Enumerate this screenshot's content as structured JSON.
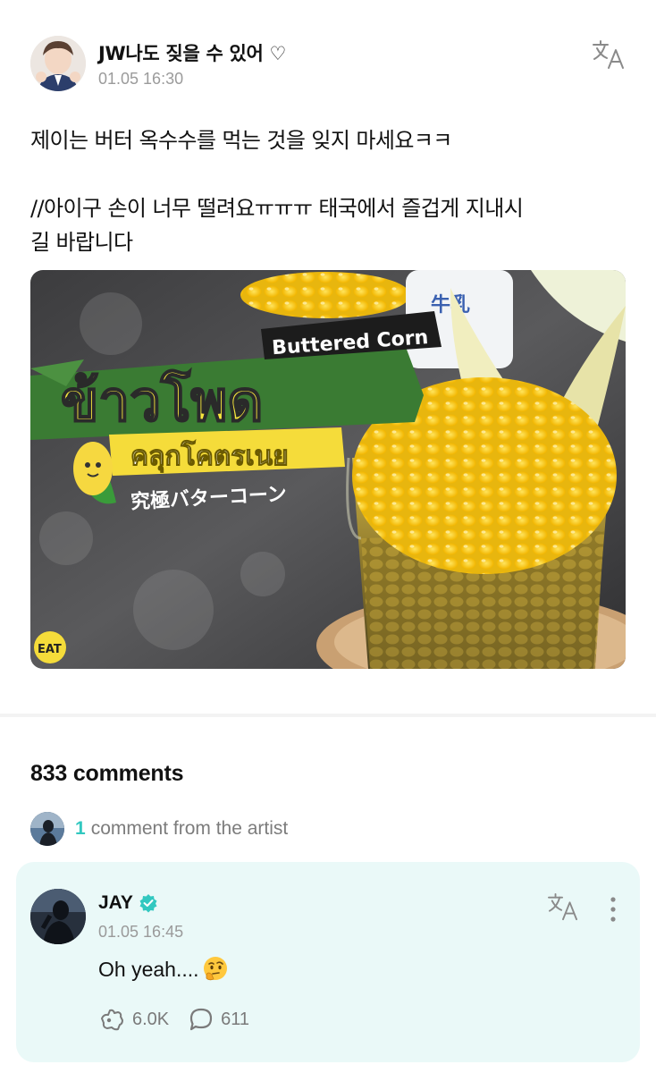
{
  "post": {
    "author": "JW나도 짖을 수 있어 ♡",
    "time": "01.05 16:30",
    "body": "제이는 버터 옥수수를 먹는 것을 잊지 마세요ㅋㅋ\n\n//아이구 손이 너무 떨려요ㅠㅠㅠ 태국에서 즐겁게 지내시\n길 바랍니다",
    "image": {
      "thai_title": "ข้าวโพด",
      "english_title": "Buttered Corn",
      "thai_subtitle": "คลุกโคตรเนย",
      "japanese_subtitle": "究極バターコーン",
      "milk_label": "牛乳",
      "logo": "EAT"
    }
  },
  "comments": {
    "count_label": "833 comments",
    "artist_count": "1",
    "artist_label": "comment from the artist"
  },
  "artist_comment": {
    "name": "JAY",
    "time": "01.05 16:45",
    "text": "Oh yeah....",
    "likes": "6.0K",
    "replies": "611"
  },
  "icons": {
    "translate": "translate-icon",
    "verified": "verified-badge-icon",
    "more": "more-vertical-icon",
    "like": "like-icon",
    "reply": "comment-bubble-icon",
    "emoji": "thinking-face-emoji"
  },
  "colors": {
    "accent": "#32c8c0",
    "card_bg": "#eaf9f8",
    "muted": "#9b9b9b"
  }
}
